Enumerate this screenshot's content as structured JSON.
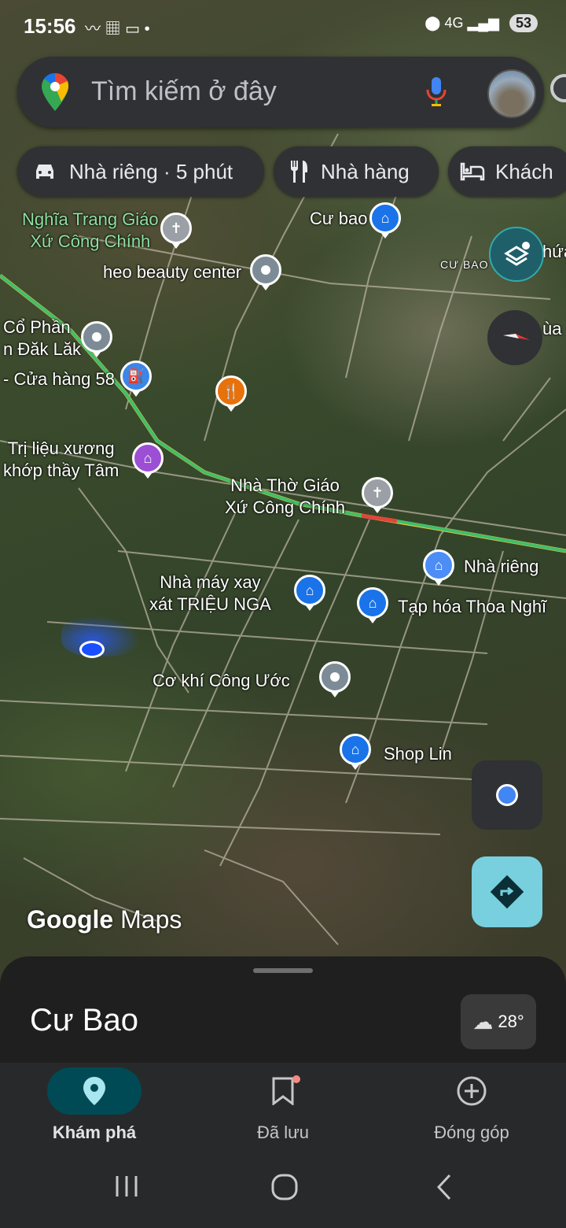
{
  "status_bar": {
    "time": "15:56",
    "network": "4G",
    "battery": "53"
  },
  "search": {
    "placeholder": "Tìm kiếm ở đây"
  },
  "chips": [
    {
      "icon": "car-icon",
      "label": "Nhà riêng · 5 phút"
    },
    {
      "icon": "fork-knife-icon",
      "label": "Nhà hàng"
    },
    {
      "icon": "bed-icon",
      "label": "Khách"
    }
  ],
  "map_labels": {
    "cemetery": "Nghĩa Trang Giáo\nXứ Công Chính",
    "cu_bao_poi": "Cư bao",
    "beauty": "heo beauty center",
    "area_cu_bao": "CƯ BAO",
    "company": "Cổ Phần\nn Đăk Lăk",
    "gas": "- Cửa hàng 58",
    "therapy": "Trị liệu xương\nkhớp thầy Tâm",
    "church": "Nhà Thờ Giáo\nXứ Công Chính",
    "home": "Nhà riêng",
    "mill": "Nhà máy xay\nxát TRIỆU NGA",
    "grocery": "Tạp hóa Thoa Nghĩ",
    "mechanic": "Cơ khí Công Ước",
    "shop": "Shop Lin",
    "edge_top": "hứa",
    "edge_mid": "ùa"
  },
  "watermark": {
    "google": "Google",
    "maps": "Maps"
  },
  "bottom_sheet": {
    "place_name": "Cư Bao",
    "temperature": "28°"
  },
  "bottom_nav": [
    {
      "icon": "location-pin-icon",
      "label": "Khám phá",
      "active": true
    },
    {
      "icon": "bookmark-icon",
      "label": "Đã lưu",
      "active": false
    },
    {
      "icon": "add-circle-icon",
      "label": "Đóng góp",
      "active": false
    }
  ],
  "colors": {
    "accent": "#004a55",
    "directions": "#78d0de",
    "poi_blue": "#1a73e8",
    "road_green": "#3fbf6a"
  }
}
